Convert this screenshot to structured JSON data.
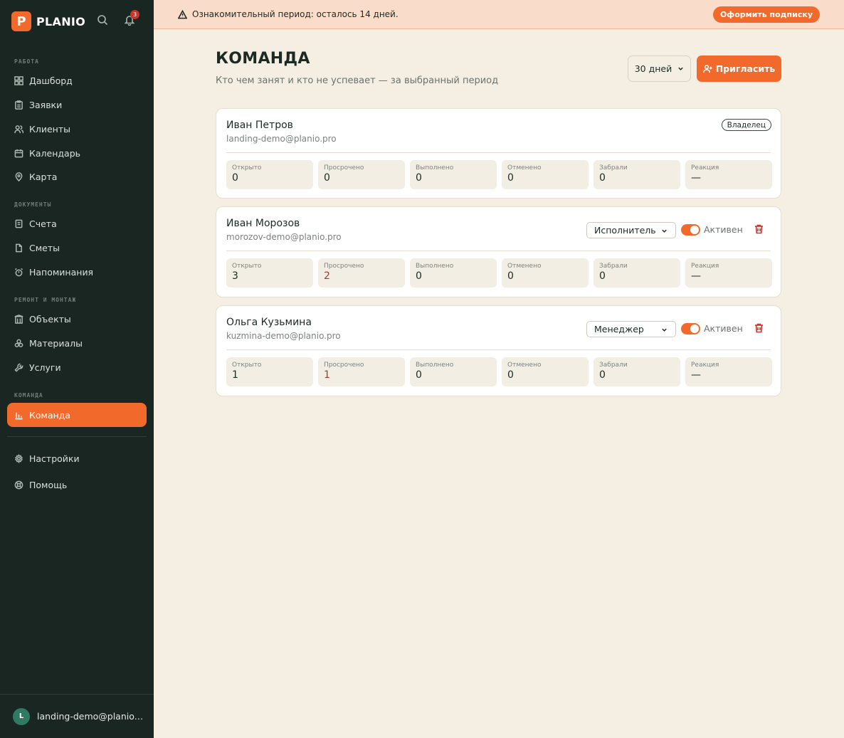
{
  "colors": {
    "accent": "#f26a2b",
    "sidebar_bg": "#1a2622",
    "page_bg": "#f5efe3",
    "danger": "#c8332b"
  },
  "brand": {
    "logo_letter": "P",
    "name": "PLANIO"
  },
  "notifications": {
    "count": "3"
  },
  "sidebar": {
    "sections": [
      {
        "label": "РАБОТА",
        "items": [
          {
            "label": "Дашборд",
            "icon": "dashboard-icon"
          },
          {
            "label": "Заявки",
            "icon": "clipboard-icon"
          },
          {
            "label": "Клиенты",
            "icon": "users-icon"
          },
          {
            "label": "Календарь",
            "icon": "calendar-icon"
          },
          {
            "label": "Карта",
            "icon": "map-pin-icon"
          }
        ]
      },
      {
        "label": "ДОКУМЕНТЫ",
        "items": [
          {
            "label": "Счета",
            "icon": "invoice-icon"
          },
          {
            "label": "Сметы",
            "icon": "file-icon"
          },
          {
            "label": "Напоминания",
            "icon": "alarm-icon"
          }
        ]
      },
      {
        "label": "РЕМОНТ И МОНТАЖ",
        "items": [
          {
            "label": "Объекты",
            "icon": "building-icon"
          },
          {
            "label": "Материалы",
            "icon": "boxes-icon"
          },
          {
            "label": "Услуги",
            "icon": "wrench-icon"
          }
        ]
      },
      {
        "label": "КОМАНДА",
        "items": [
          {
            "label": "Команда",
            "icon": "bar-chart-icon"
          }
        ]
      }
    ],
    "bottom": [
      {
        "label": "Настройки",
        "icon": "gear-icon"
      },
      {
        "label": "Помощь",
        "icon": "help-icon"
      }
    ],
    "user": {
      "initial": "L",
      "email": "landing-demo@planio.pro"
    }
  },
  "banner": {
    "text": "Ознакомительный период: осталось 14 дней.",
    "cta": "Оформить подписку"
  },
  "header": {
    "title": "КОМАНДА",
    "subtitle": "Кто чем занят и кто не успевает — за выбранный период",
    "period": "30 дней",
    "invite": "Пригласить"
  },
  "stat_labels": [
    "Открыто",
    "Просрочено",
    "Выполнено",
    "Отменено",
    "Забрали",
    "Реакция"
  ],
  "members": [
    {
      "name": "Иван Петров",
      "email": "landing-demo@planio.pro",
      "badge": "Владелец",
      "stats": [
        "0",
        "0",
        "0",
        "0",
        "0",
        "—"
      ]
    },
    {
      "name": "Иван Морозов",
      "email": "morozov-demo@planio.pro",
      "role": "Исполнитель",
      "status": "Активен",
      "stats": [
        "3",
        "2",
        "0",
        "0",
        "0",
        "—"
      ]
    },
    {
      "name": "Ольга Кузьмина",
      "email": "kuzmina-demo@planio.pro",
      "role": "Менеджер",
      "status": "Активен",
      "stats": [
        "1",
        "1",
        "0",
        "0",
        "0",
        "—"
      ]
    }
  ]
}
